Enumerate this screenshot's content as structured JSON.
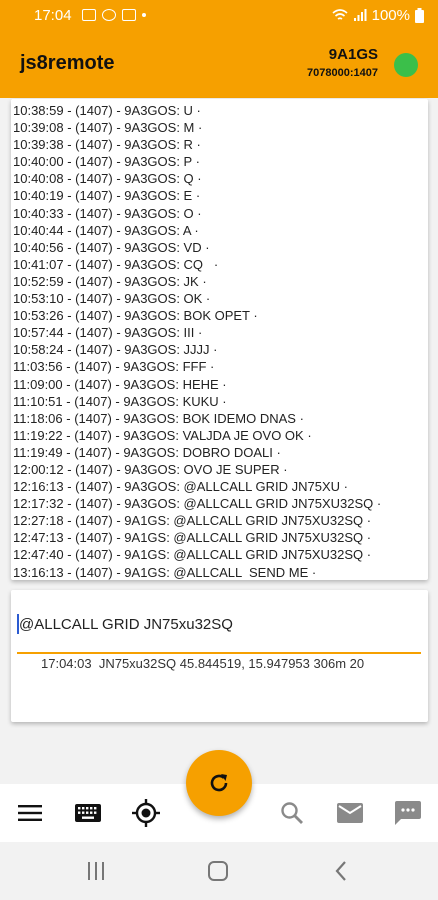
{
  "status_bar": {
    "time": "17:04",
    "battery": "100%"
  },
  "app_bar": {
    "title": "js8remote",
    "callsign": "9A1GS",
    "frequency": "7078000:1407",
    "status_color": "#3bbf4a"
  },
  "log": {
    "lines": [
      "10:38:59 - (1407) - 9A3GOS: U ·",
      "10:39:08 - (1407) - 9A3GOS: M ·",
      "10:39:38 - (1407) - 9A3GOS: R ·",
      "10:40:00 - (1407) - 9A3GOS: P ·",
      "10:40:08 - (1407) - 9A3GOS: Q ·",
      "10:40:19 - (1407) - 9A3GOS: E ·",
      "10:40:33 - (1407) - 9A3GOS: O ·",
      "10:40:44 - (1407) - 9A3GOS: A ·",
      "10:40:56 - (1407) - 9A3GOS: VD ·",
      "10:41:07 - (1407) - 9A3GOS: CQ   ·",
      "10:52:59 - (1407) - 9A3GOS: JK ·",
      "10:53:10 - (1407) - 9A3GOS: OK ·",
      "10:53:26 - (1407) - 9A3GOS: BOK OPET ·",
      "10:57:44 - (1407) - 9A3GOS: III ·",
      "10:58:24 - (1407) - 9A3GOS: JJJJ ·",
      "11:03:56 - (1407) - 9A3GOS: FFF ·",
      "11:09:00 - (1407) - 9A3GOS: HEHE ·",
      "11:10:51 - (1407) - 9A3GOS: KUKU ·",
      "11:18:06 - (1407) - 9A3GOS: BOK IDEMO DNAS ·",
      "11:19:22 - (1407) - 9A3GOS: VALJDA JE OVO OK ·",
      "11:19:49 - (1407) - 9A3GOS: DOBRO DOALI ·",
      "12:00:12 - (1407) - 9A3GOS: OVO JE SUPER ·",
      "12:16:13 - (1407) - 9A3GOS: @ALLCALL GRID JN75XU ·",
      "12:17:32 - (1407) - 9A3GOS: @ALLCALL GRID JN75XU32SQ ·",
      "12:27:18 - (1407) - 9A1GS: @ALLCALL GRID JN75XU32SQ ·",
      "12:47:13 - (1407) - 9A1GS: @ALLCALL GRID JN75XU32SQ ·",
      "12:47:40 - (1407) - 9A1GS: @ALLCALL GRID JN75XU32SQ ·",
      "13:16:13 - (1407) - 9A1GS: @ALLCALL  SEND ME ·"
    ]
  },
  "composer": {
    "message": "@ALLCALL GRID JN75xu32SQ",
    "info": "17:04:03  JN75xu32SQ 45.844519, 15.947953 306m 20"
  },
  "bottom_nav": {
    "icons": [
      "menu-icon",
      "keyboard-icon",
      "gps-target-icon",
      "refresh-icon",
      "search-icon",
      "mail-icon",
      "chat-icon"
    ]
  },
  "system_nav": {
    "icons": [
      "recents-icon",
      "home-icon",
      "back-icon"
    ]
  }
}
